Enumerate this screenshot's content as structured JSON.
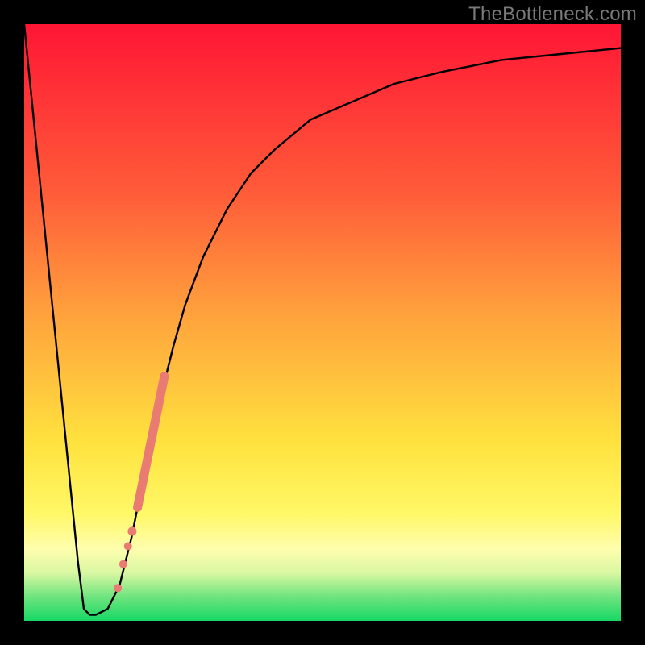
{
  "watermark": "TheBottleneck.com",
  "chart_data": {
    "type": "line",
    "title": "",
    "xlabel": "",
    "ylabel": "",
    "xlim": [
      0,
      100
    ],
    "ylim": [
      0,
      100
    ],
    "grid": false,
    "legend": false,
    "series": [
      {
        "name": "bottleneck-curve",
        "x": [
          0,
          2,
          4,
          6,
          8,
          9,
          10,
          11,
          12,
          14,
          16,
          18,
          19,
          20,
          21,
          22,
          23,
          25,
          27,
          30,
          34,
          38,
          42,
          48,
          55,
          62,
          70,
          80,
          90,
          100
        ],
        "y": [
          100,
          80,
          60,
          40,
          20,
          10,
          2,
          1,
          1,
          2,
          6,
          14,
          19,
          24,
          28,
          33,
          38,
          46,
          53,
          61,
          69,
          75,
          79,
          84,
          87,
          90,
          92,
          94,
          95,
          96
        ]
      }
    ],
    "markers": [
      {
        "name": "highlight-segment",
        "kind": "line-segment",
        "x0": 19.0,
        "y0": 19,
        "x1": 23.5,
        "y1": 41,
        "color": "#e97b73",
        "width": 11
      },
      {
        "name": "dot-1",
        "kind": "dot",
        "x": 18.1,
        "y": 15.0,
        "r": 5.5,
        "color": "#e97b73"
      },
      {
        "name": "dot-2",
        "kind": "dot",
        "x": 17.4,
        "y": 12.5,
        "r": 5.0,
        "color": "#e97b73"
      },
      {
        "name": "dot-3",
        "kind": "dot",
        "x": 16.6,
        "y": 9.5,
        "r": 5.0,
        "color": "#e97b73"
      },
      {
        "name": "dot-4",
        "kind": "dot",
        "x": 15.7,
        "y": 5.5,
        "r": 5.0,
        "color": "#e97b73"
      }
    ],
    "colors": {
      "curve": "#000000",
      "marker": "#e97b73",
      "frame": "#000000"
    }
  }
}
